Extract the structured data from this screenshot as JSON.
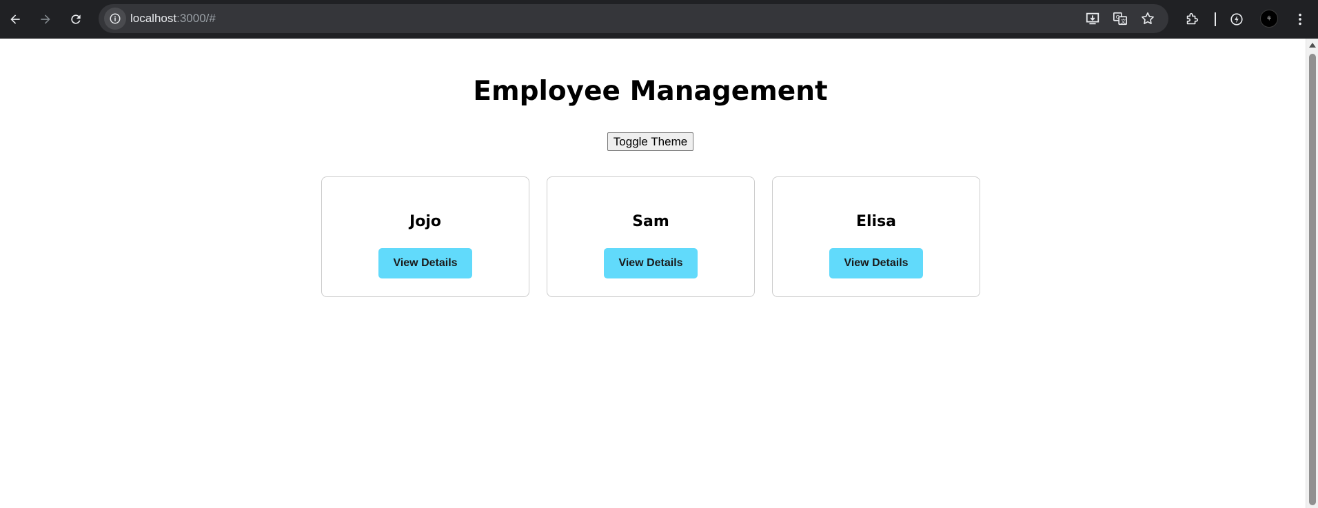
{
  "browser": {
    "url_host": "localhost",
    "url_rest": ":3000/#",
    "avatar_label": "⚘"
  },
  "page": {
    "title": "Employee Management",
    "toggle_label": "Toggle Theme",
    "employees": [
      {
        "name": "Jojo",
        "button_label": "View Details"
      },
      {
        "name": "Sam",
        "button_label": "View Details"
      },
      {
        "name": "Elisa",
        "button_label": "View Details"
      }
    ]
  },
  "colors": {
    "accent": "#61dafb",
    "chrome_bg": "#202124",
    "omnibox_bg": "#35363a"
  }
}
